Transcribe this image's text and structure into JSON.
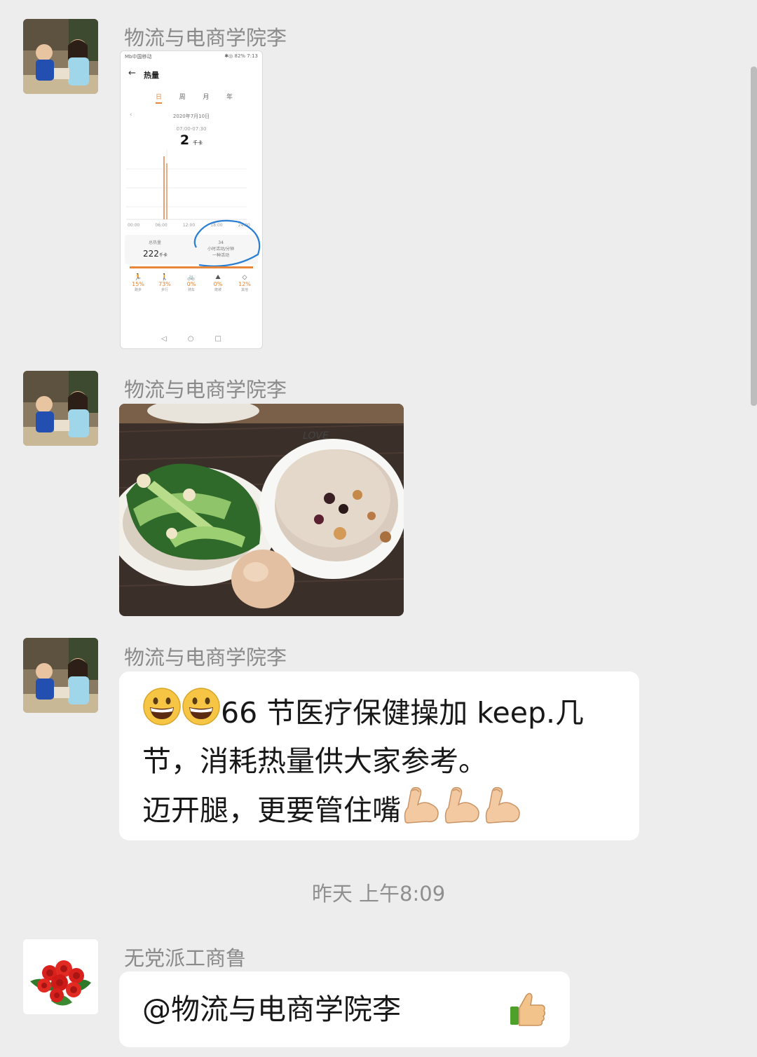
{
  "messages": [
    {
      "sender": "物流与电商学院李",
      "type": "image",
      "image": "calorie-app-screenshot"
    },
    {
      "sender": "物流与电商学院李",
      "type": "image",
      "image": "breakfast-photo"
    },
    {
      "sender": "物流与电商学院李",
      "type": "text",
      "line1": "66 节医疗保健操加 keep.几",
      "line2": "节，消耗热量供大家参考。",
      "line3": "迈开腿，更要管住嘴"
    },
    {
      "sender": "无党派工商鲁",
      "type": "text",
      "text": "@物流与电商学院李"
    }
  ],
  "timestamp": "昨天 上午8:09",
  "screenshot": {
    "status": "Mb中国移动",
    "status_right": "✱◎ 82% 7:13",
    "title": "热量",
    "tabs": [
      "日",
      "周",
      "月",
      "年"
    ],
    "date": "2020年7月10日",
    "time_range": "07:00-07:30",
    "value": "2",
    "value_unit": "千卡",
    "axis_labels": [
      "00:00",
      "06:00",
      "12:00",
      "18:00",
      "24:00"
    ],
    "total_label": "总热量",
    "total_value": "222",
    "total_unit": "千卡",
    "circled_value": "34",
    "circled_text1": "小时活动/分钟",
    "circled_text2": "一种活动",
    "activities": [
      {
        "pct": "15%",
        "label": "跑步"
      },
      {
        "pct": "73%",
        "label": "步行"
      },
      {
        "pct": "0%",
        "label": "骑车"
      },
      {
        "pct": "0%",
        "label": "爬坡"
      },
      {
        "pct": "12%",
        "label": "其他"
      }
    ]
  },
  "colors": {
    "background": "#ededed",
    "bubble": "#ffffff",
    "sender": "#8a8a8a",
    "accent": "#e8863a",
    "circle": "#2a7fd4"
  }
}
